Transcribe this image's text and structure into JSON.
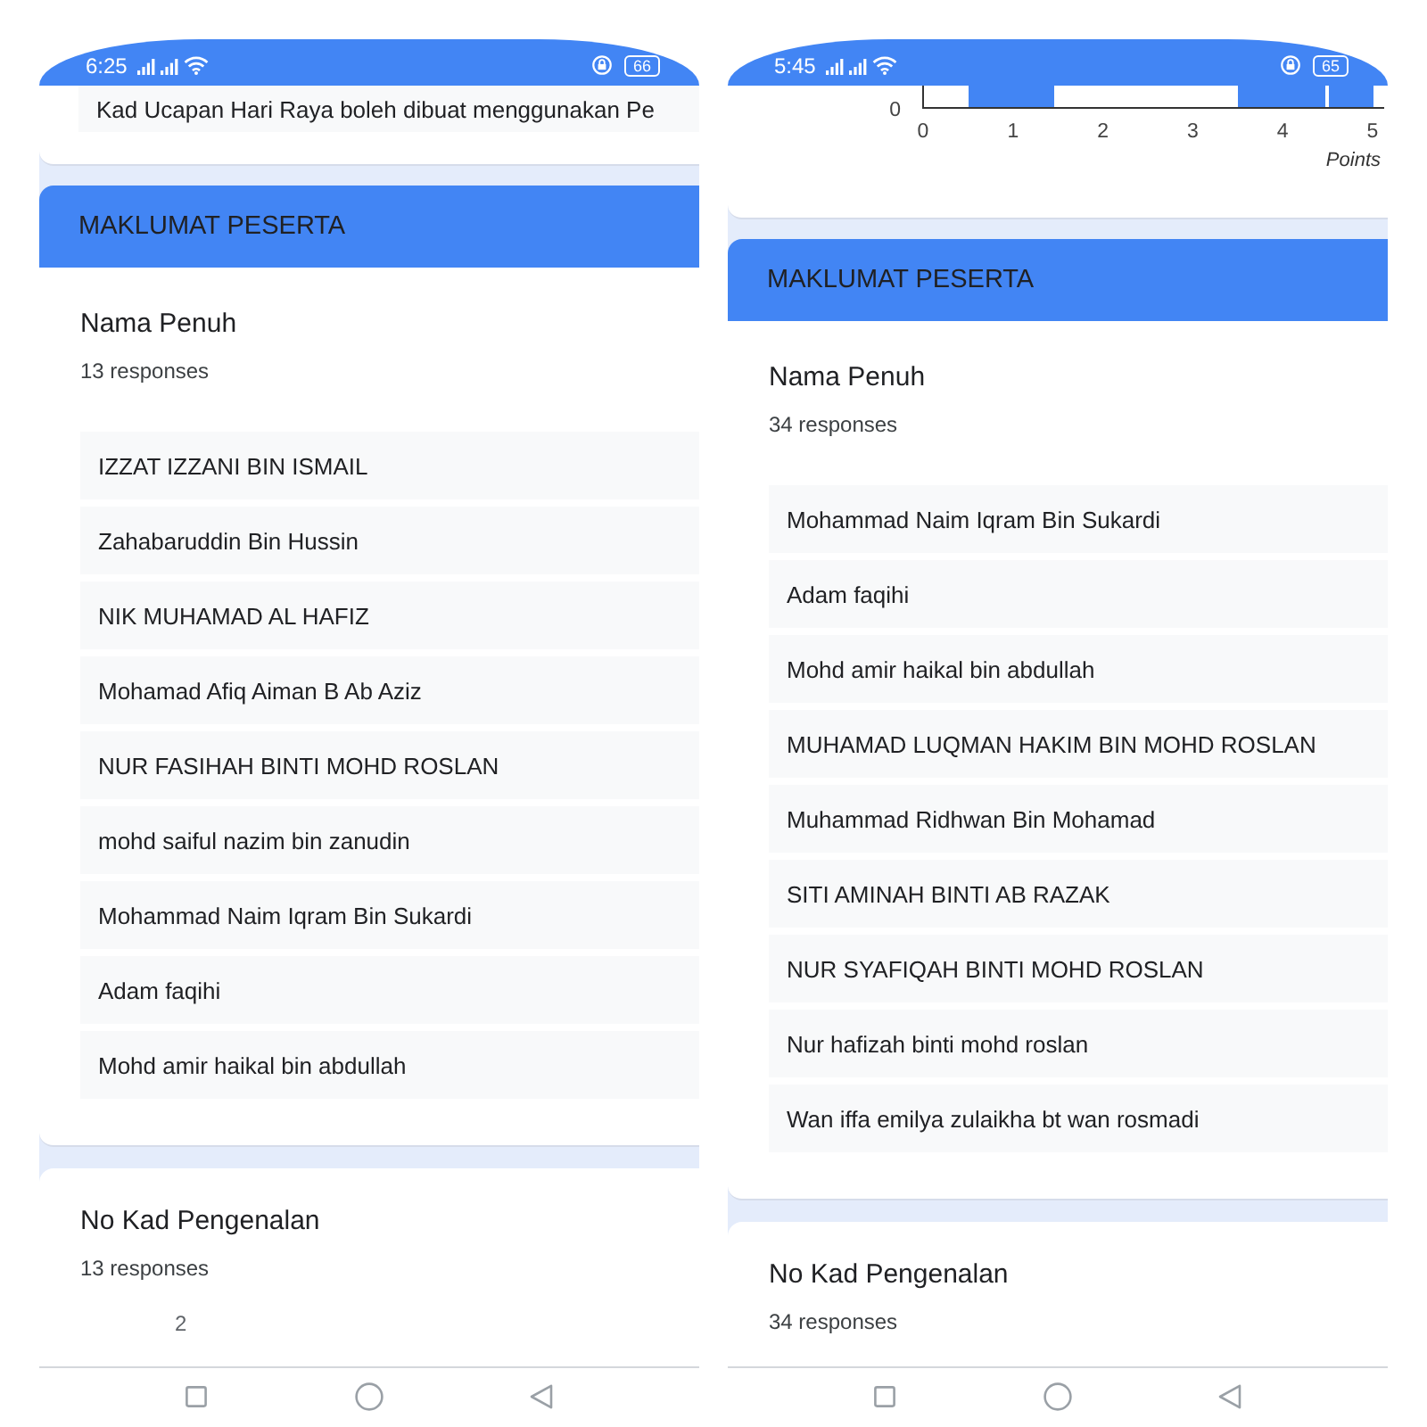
{
  "phones": [
    {
      "status_bar": {
        "time": "6:25",
        "battery": "66"
      },
      "top_card": {
        "kind": "responses",
        "responses": [
          "Kad Ucapan Hari Raya boleh dibuat menggunakan Pe"
        ]
      },
      "section_header": "MAKLUMAT PESERTA",
      "questions": [
        {
          "title": "Nama Penuh",
          "count": "13 responses",
          "responses": [
            "IZZAT IZZANI BIN ISMAIL",
            "Zahabaruddin Bin Hussin",
            "NIK MUHAMAD AL HAFIZ",
            "Mohamad Afiq Aiman B Ab Aziz",
            "NUR FASIHAH BINTI MOHD ROSLAN",
            "mohd saiful nazim bin zanudin",
            "Mohammad Naim Iqram Bin Sukardi",
            "Adam faqihi",
            "Mohd amir haikal bin abdullah"
          ]
        },
        {
          "title": "No Kad Pengenalan",
          "count": "13 responses",
          "axis_label": "2"
        }
      ]
    },
    {
      "status_bar": {
        "time": "5:45",
        "battery": "65"
      },
      "top_card": {
        "kind": "chart",
        "y_tick": "0",
        "x_ticks": [
          "0",
          "1",
          "2",
          "3",
          "4",
          "5"
        ],
        "x_label": "Points"
      },
      "section_header": "MAKLUMAT PESERTA",
      "questions": [
        {
          "title": "Nama Penuh",
          "count": "34 responses",
          "responses": [
            "Mohammad Naim Iqram Bin Sukardi",
            "Adam faqihi",
            "Mohd amir haikal bin abdullah",
            "MUHAMAD LUQMAN HAKIM BIN MOHD ROSLAN",
            "Muhammad Ridhwan Bin Mohamad",
            "SITI AMINAH BINTI AB RAZAK",
            "NUR SYAFIQAH BINTI MOHD ROSLAN",
            "Nur hafizah binti mohd roslan",
            "Wan iffa emilya zulaikha bt wan rosmadi"
          ]
        },
        {
          "title": "No Kad Pengenalan",
          "count": "34 responses"
        }
      ]
    }
  ]
}
